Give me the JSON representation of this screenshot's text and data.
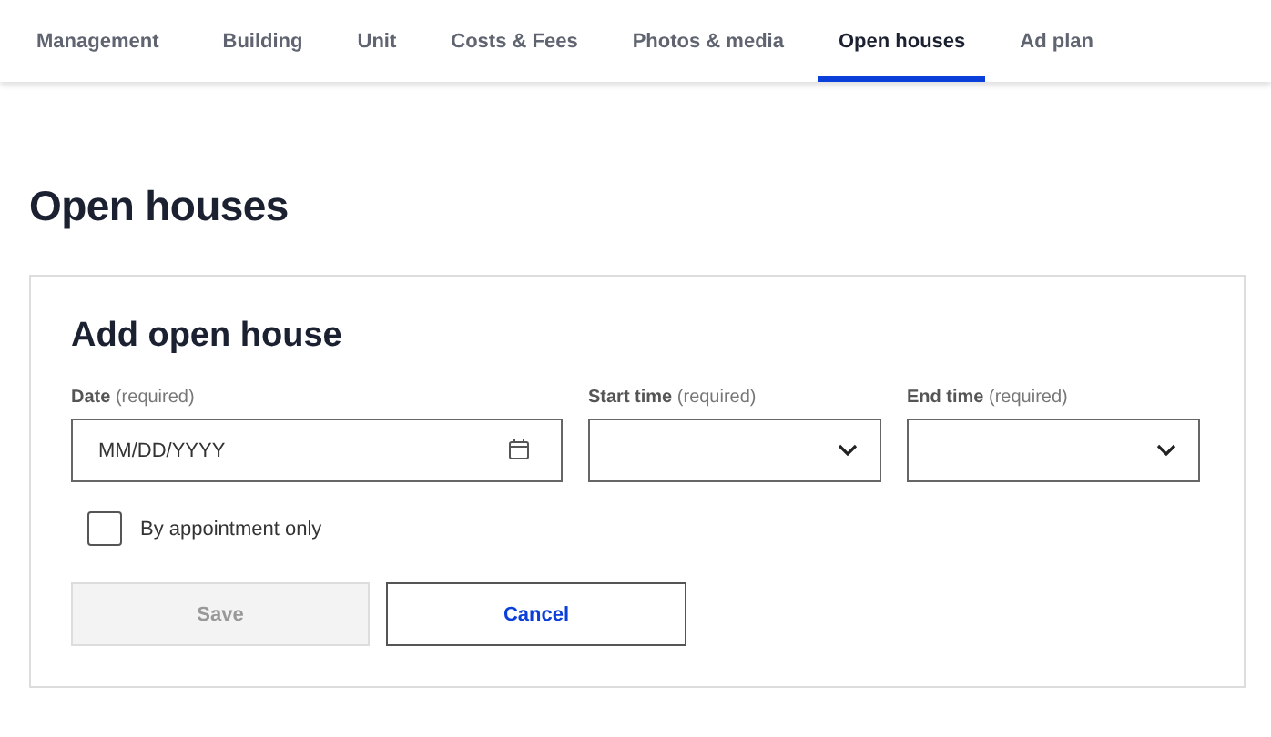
{
  "tabs": [
    {
      "label": "Management",
      "selected": false
    },
    {
      "label": "Building",
      "selected": false
    },
    {
      "label": "Unit",
      "selected": false
    },
    {
      "label": "Costs & Fees",
      "selected": false
    },
    {
      "label": "Photos & media",
      "selected": false
    },
    {
      "label": "Open houses",
      "selected": true
    },
    {
      "label": "Ad plan",
      "selected": false
    }
  ],
  "page_title": "Open houses",
  "form": {
    "title": "Add open house",
    "fields": [
      {
        "kind": "date",
        "label": "**Date** (required)",
        "placeholder": "MM/DD/YYYY"
      },
      {
        "kind": "select",
        "label": "**Start time** (required)"
      },
      {
        "kind": "select",
        "label": "**End time** (required)"
      }
    ],
    "checkbox": {
      "label": "By appointment only",
      "checked": false
    },
    "buttons": [
      {
        "label": "Save",
        "disabled": true
      },
      {
        "label": "Cancel",
        "disabled": false
      }
    ]
  }
}
